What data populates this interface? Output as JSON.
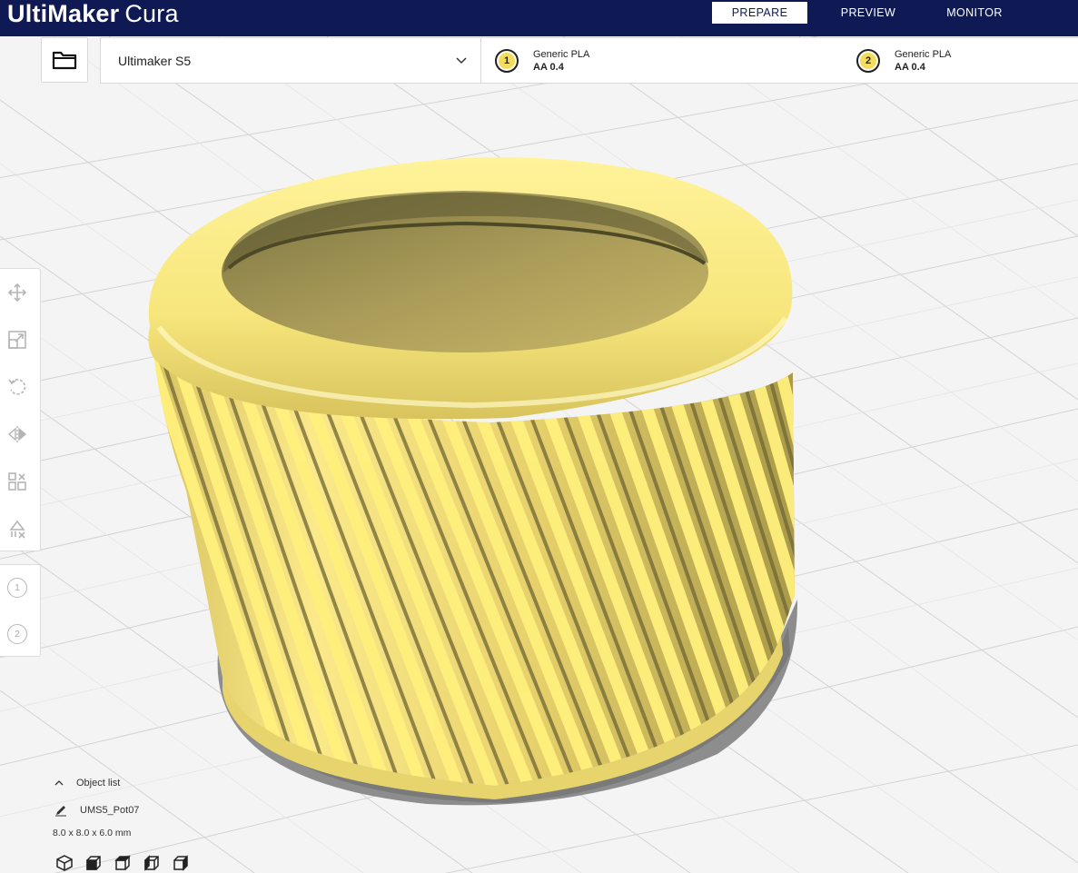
{
  "app": {
    "brand_bold": "UltiMaker",
    "brand_light": "Cura"
  },
  "stages": [
    {
      "label": "PREPARE",
      "active": true
    },
    {
      "label": "PREVIEW",
      "active": false
    },
    {
      "label": "MONITOR",
      "active": false
    }
  ],
  "header": {
    "printer": "Ultimaker S5",
    "extruders": [
      {
        "number": "1",
        "material": "Generic PLA",
        "nozzle": "AA 0.4"
      },
      {
        "number": "2",
        "material": "Generic PLA",
        "nozzle": "AA 0.4"
      }
    ]
  },
  "toolbar": {
    "tools": [
      "move-icon",
      "scale-icon",
      "rotate-icon",
      "mirror-icon",
      "per-model-settings-icon",
      "support-blocker-icon"
    ]
  },
  "extruder_buttons": [
    "1",
    "2"
  ],
  "object_list": {
    "label": "Object list",
    "object_name": "UMS5_Pot07",
    "dimensions": "8.0 x 8.0 x 6.0 mm"
  },
  "colors": {
    "topbar": "#0f1a55",
    "model_yellow": "#f5e27a",
    "model_shadow": "#8a8a8a",
    "grid_line": "#d0d0d0",
    "build_plate": "#f4f4f4"
  }
}
